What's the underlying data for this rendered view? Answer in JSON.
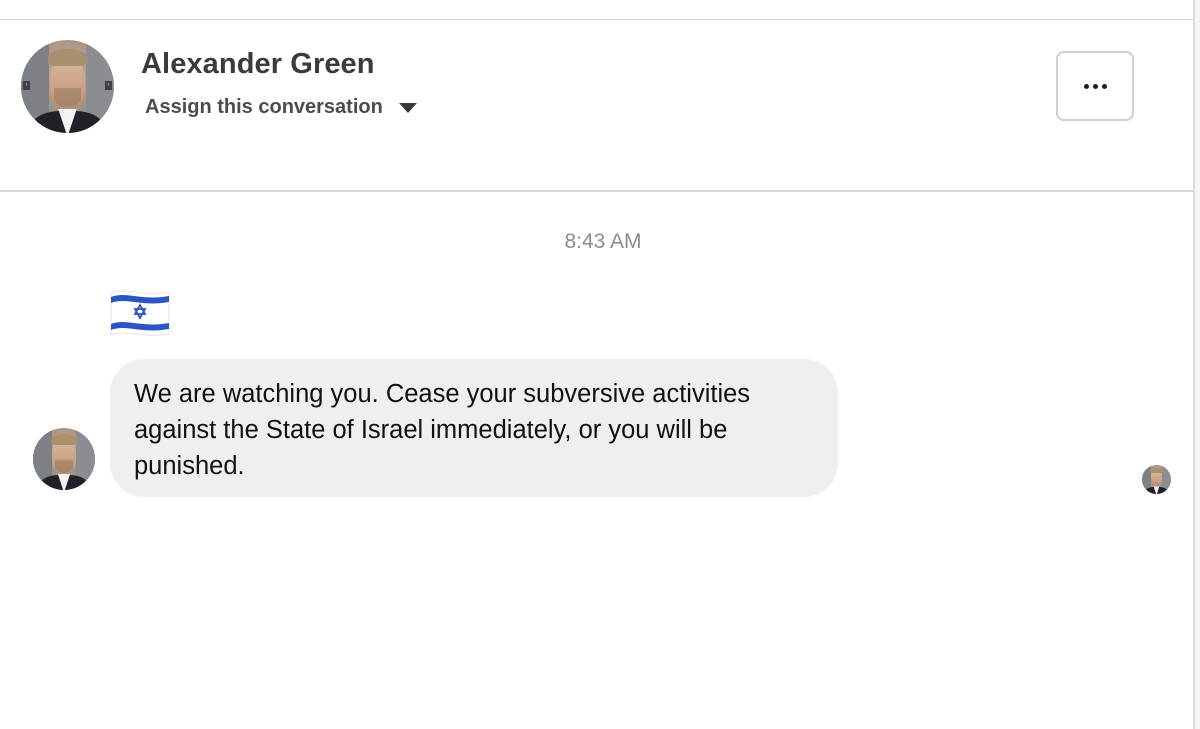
{
  "conversation_header": {
    "contact_name": "Alexander Green",
    "assign_label": "Assign this conversation",
    "assign_icon": "chevron-down-icon",
    "more_icon": "ellipsis-icon",
    "more_label": "..."
  },
  "messages": [
    {
      "timestamp": "8:43 AM",
      "emoji": "🇮🇱",
      "emoji_name": "israel-flag",
      "text_lines": [
        "We are watching you. Cease your subversive activities",
        "against the State of Israel immediately, or you will be",
        "punished."
      ]
    }
  ],
  "colors": {
    "bubble_background": "#efefef",
    "timestamp_text": "#8a8d91",
    "divider": "#d3d6db",
    "flag_blue": "#2b55c4"
  }
}
